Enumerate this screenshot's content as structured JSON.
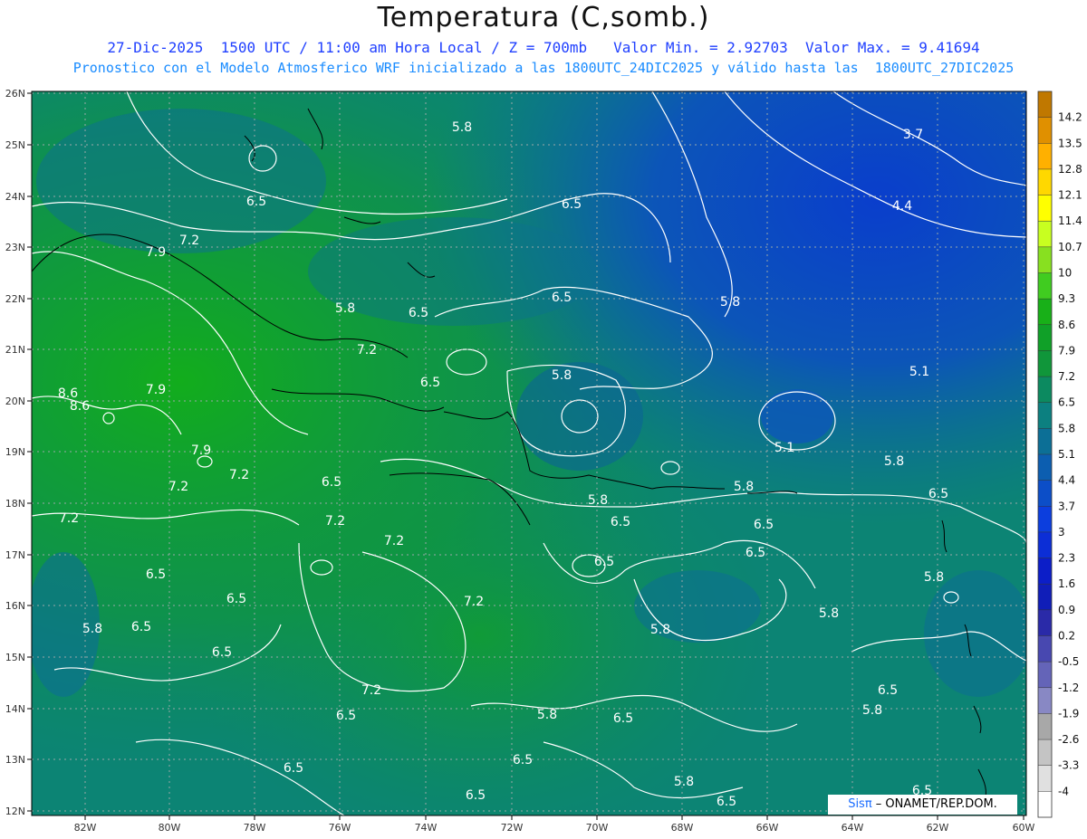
{
  "title": "Temperatura (C,somb.)",
  "subtitle_line1": "27-Dic-2025  1500 UTC / 11:00 am Hora Local / Z = 700mb   Valor Min. = 2.92703  Valor Max. = 9.41694",
  "subtitle_line2": "Pronostico con el Modelo Atmosferico WRF inicializado a las 1800UTC_24DIC2025 y válido hasta las  1800UTC_27DIC2025",
  "credit": {
    "brand": "Sisπ",
    "org": " – ONAMET/REP.DOM."
  },
  "axes": {
    "lon_labels": [
      "82W",
      "80W",
      "78W",
      "76W",
      "74W",
      "72W",
      "70W",
      "68W",
      "66W",
      "64W",
      "62W",
      "60W"
    ],
    "lat_labels": [
      "26N",
      "25N",
      "24N",
      "23N",
      "22N",
      "21N",
      "20N",
      "19N",
      "18N",
      "17N",
      "16N",
      "15N",
      "14N",
      "13N",
      "12N"
    ]
  },
  "colorbar": {
    "levels": [
      "14.2",
      "13.5",
      "12.8",
      "12.1",
      "11.4",
      "10.7",
      "10",
      "9.3",
      "8.6",
      "7.9",
      "7.2",
      "6.5",
      "5.8",
      "5.1",
      "4.4",
      "3.7",
      "3",
      "2.3",
      "1.6",
      "0.9",
      "0.2",
      "-0.5",
      "-1.2",
      "-1.9",
      "-2.6",
      "-3.3",
      "-4"
    ],
    "colors": [
      "#c07800",
      "#e09000",
      "#ffb000",
      "#ffd800",
      "#ffff00",
      "#c8ff20",
      "#88e020",
      "#40cc20",
      "#18b018",
      "#10a028",
      "#10963a",
      "#0c8a60",
      "#0c8080",
      "#0c6f96",
      "#0c5eb0",
      "#0c4ec8",
      "#0c3ede",
      "#0c2ed6",
      "#0c1ec8",
      "#101eb8",
      "#2a2aa8",
      "#4848b0",
      "#6464b8",
      "#8888c4",
      "#a8a8a8",
      "#c4c4c4",
      "#e0e0e0",
      "#ffffff"
    ]
  },
  "contour_labels": [
    {
      "text": "5.8"
    },
    {
      "text": "3.7"
    },
    {
      "text": "4.4"
    },
    {
      "text": "6.5"
    },
    {
      "text": "6.5"
    },
    {
      "text": "7.9"
    },
    {
      "text": "7.2"
    },
    {
      "text": "5.8"
    },
    {
      "text": "6.5"
    },
    {
      "text": "6.5"
    },
    {
      "text": "5.8"
    },
    {
      "text": "7.2"
    },
    {
      "text": "5.1"
    },
    {
      "text": "6.5"
    },
    {
      "text": "5.8"
    },
    {
      "text": "8.6"
    },
    {
      "text": "7.9"
    },
    {
      "text": "8.6"
    },
    {
      "text": "7.9"
    },
    {
      "text": "5.1"
    },
    {
      "text": "7.2"
    },
    {
      "text": "7.2"
    },
    {
      "text": "6.5"
    },
    {
      "text": "5.8"
    },
    {
      "text": "5.8"
    },
    {
      "text": "5.8"
    },
    {
      "text": "6.5"
    },
    {
      "text": "7.2"
    },
    {
      "text": "7.2"
    },
    {
      "text": "6.5"
    },
    {
      "text": "6.5"
    },
    {
      "text": "7.2"
    },
    {
      "text": "6.5"
    },
    {
      "text": "6.5"
    },
    {
      "text": "6.5"
    },
    {
      "text": "6.5"
    },
    {
      "text": "5.8"
    },
    {
      "text": "7.2"
    },
    {
      "text": "5.8"
    },
    {
      "text": "5.8"
    },
    {
      "text": "6.5"
    },
    {
      "text": "5.8"
    },
    {
      "text": "6.5"
    },
    {
      "text": "7.2"
    },
    {
      "text": "6.5"
    },
    {
      "text": "6.5"
    },
    {
      "text": "5.8"
    },
    {
      "text": "6.5"
    },
    {
      "text": "5.8"
    },
    {
      "text": "6.5"
    },
    {
      "text": "6.5"
    },
    {
      "text": "6.5"
    },
    {
      "text": "5.8"
    },
    {
      "text": "6.5"
    },
    {
      "text": "6.5"
    }
  ]
}
